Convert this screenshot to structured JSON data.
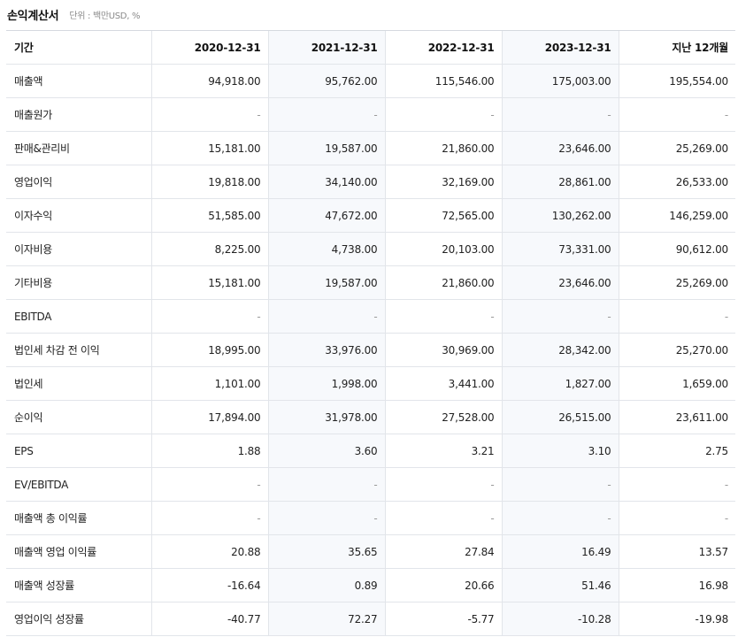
{
  "header": {
    "title": "손익계산서",
    "unit": "단위 : 백만USD, %"
  },
  "table": {
    "columns": [
      "기간",
      "2020-12-31",
      "2021-12-31",
      "2022-12-31",
      "2023-12-31",
      "지난 12개월"
    ],
    "rows": [
      {
        "label": "매출액",
        "values": [
          "94,918.00",
          "95,762.00",
          "115,546.00",
          "175,003.00",
          "195,554.00"
        ]
      },
      {
        "label": "매출원가",
        "values": [
          "-",
          "-",
          "-",
          "-",
          "-"
        ]
      },
      {
        "label": "판매&관리비",
        "values": [
          "15,181.00",
          "19,587.00",
          "21,860.00",
          "23,646.00",
          "25,269.00"
        ]
      },
      {
        "label": "영업이익",
        "values": [
          "19,818.00",
          "34,140.00",
          "32,169.00",
          "28,861.00",
          "26,533.00"
        ]
      },
      {
        "label": "이자수익",
        "values": [
          "51,585.00",
          "47,672.00",
          "72,565.00",
          "130,262.00",
          "146,259.00"
        ]
      },
      {
        "label": "이자비용",
        "values": [
          "8,225.00",
          "4,738.00",
          "20,103.00",
          "73,331.00",
          "90,612.00"
        ]
      },
      {
        "label": "기타비용",
        "values": [
          "15,181.00",
          "19,587.00",
          "21,860.00",
          "23,646.00",
          "25,269.00"
        ]
      },
      {
        "label": "EBITDA",
        "values": [
          "-",
          "-",
          "-",
          "-",
          "-"
        ]
      },
      {
        "label": "법인세 차감 전 이익",
        "values": [
          "18,995.00",
          "33,976.00",
          "30,969.00",
          "28,342.00",
          "25,270.00"
        ]
      },
      {
        "label": "법인세",
        "values": [
          "1,101.00",
          "1,998.00",
          "3,441.00",
          "1,827.00",
          "1,659.00"
        ]
      },
      {
        "label": "순이익",
        "values": [
          "17,894.00",
          "31,978.00",
          "27,528.00",
          "26,515.00",
          "23,611.00"
        ]
      },
      {
        "label": "EPS",
        "values": [
          "1.88",
          "3.60",
          "3.21",
          "3.10",
          "2.75"
        ]
      },
      {
        "label": "EV/EBITDA",
        "values": [
          "-",
          "-",
          "-",
          "-",
          "-"
        ]
      },
      {
        "label": "매출액 총 이익률",
        "values": [
          "-",
          "-",
          "-",
          "-",
          "-"
        ]
      },
      {
        "label": "매출액 영업 이익률",
        "values": [
          "20.88",
          "35.65",
          "27.84",
          "16.49",
          "13.57"
        ]
      },
      {
        "label": "매출액 성장률",
        "values": [
          "-16.64",
          "0.89",
          "20.66",
          "51.46",
          "16.98"
        ]
      },
      {
        "label": "영업이익 성장률",
        "values": [
          "-40.77",
          "72.27",
          "-5.77",
          "-10.28",
          "-19.98"
        ]
      }
    ]
  }
}
